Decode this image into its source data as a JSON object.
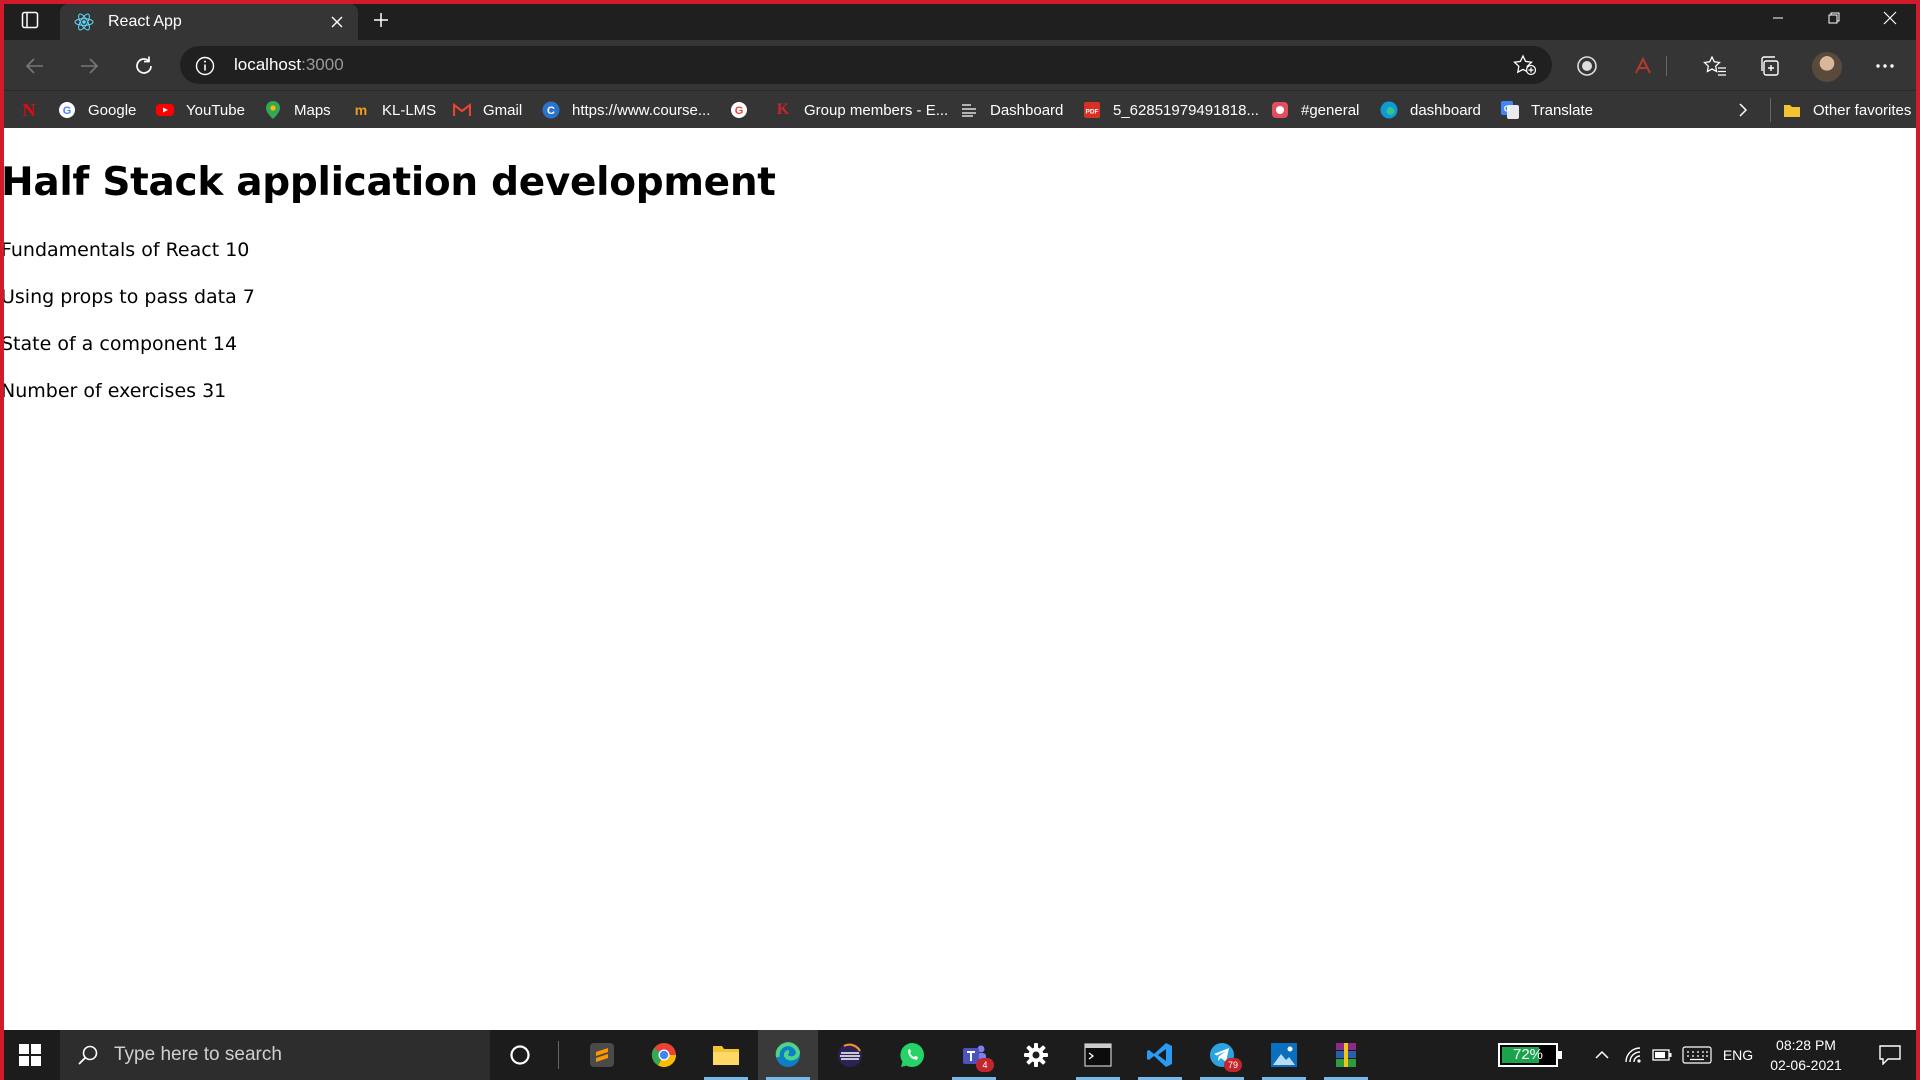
{
  "browser": {
    "tab_title": "React App",
    "url_host": "localhost",
    "url_port": ":3000"
  },
  "bookmarks": [
    {
      "label": "",
      "icon": "netflix-icon",
      "color": "#e50914"
    },
    {
      "label": "Google",
      "icon": "google-icon"
    },
    {
      "label": "YouTube",
      "icon": "youtube-icon",
      "color": "#ff0000"
    },
    {
      "label": "Maps",
      "icon": "maps-icon"
    },
    {
      "label": "KL-LMS",
      "icon": "kl-lms-icon"
    },
    {
      "label": "Gmail",
      "icon": "gmail-icon"
    },
    {
      "label": "https://www.course...",
      "icon": "coursera-icon"
    },
    {
      "label": "",
      "icon": "google-icon"
    },
    {
      "label": "Group members - E...",
      "icon": "group-icon"
    },
    {
      "label": "Dashboard",
      "icon": "dashboard-icon"
    },
    {
      "label": "5_62851979491818...",
      "icon": "pdf-icon"
    },
    {
      "label": "#general",
      "icon": "discord-icon"
    },
    {
      "label": "dashboard",
      "icon": "edge-icon"
    },
    {
      "label": "Translate",
      "icon": "translate-icon"
    }
  ],
  "other_favorites": "Other favorites",
  "page": {
    "heading": "Half Stack application development",
    "parts": [
      "Fundamentals of React 10",
      "Using props to pass data 7",
      "State of a component 14"
    ],
    "total": "Number of exercises 31"
  },
  "taskbar": {
    "search_placeholder": "Type here to search",
    "battery_percent": "72%",
    "battery_level": 0.72,
    "language": "ENG",
    "time": "08:28 PM",
    "date": "02-06-2021",
    "teams_badge": "4",
    "telegram_badge": "79"
  }
}
